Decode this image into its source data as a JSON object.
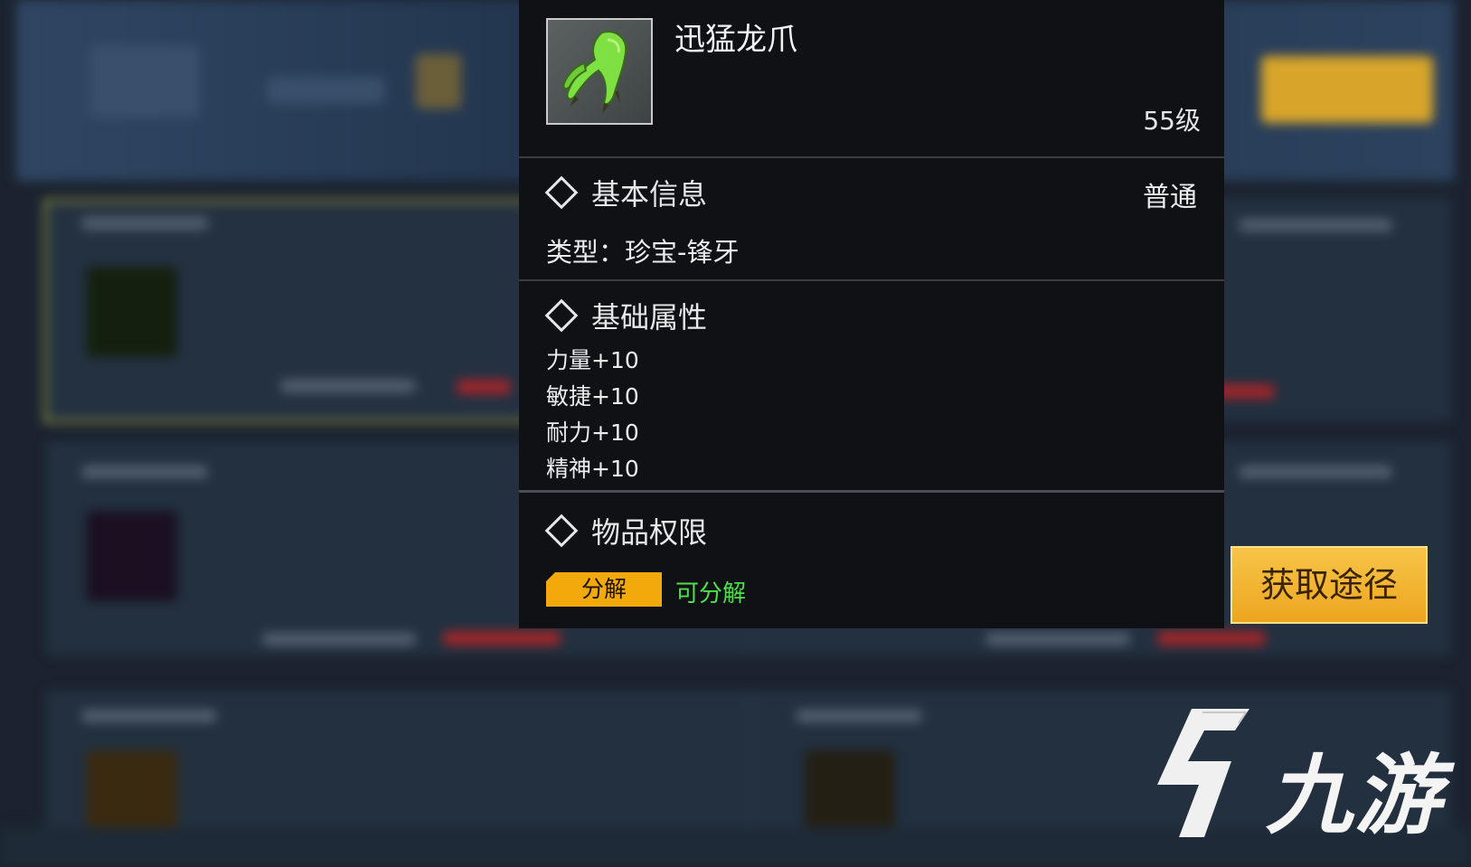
{
  "item": {
    "name": "迅猛龙爪",
    "level": "55级",
    "icon": "green-claw-icon"
  },
  "basic_info": {
    "heading": "基本信息",
    "rarity": "普通",
    "type_line": "类型：珍宝-锋牙"
  },
  "base_attributes": {
    "heading": "基础属性",
    "stats": [
      "力量+10",
      "敏捷+10",
      "耐力+10",
      "精神+10"
    ]
  },
  "permissions": {
    "heading": "物品权限",
    "tag_label": "分解",
    "tag_desc": "可分解"
  },
  "acquire_button": "获取途径",
  "watermark": {
    "text": "九游",
    "icon": "jiuyou-logo-icon"
  },
  "colors": {
    "panel_bg": "#0f1115",
    "tag_bg": "#f2a90c",
    "tag_desc": "#4ee04a",
    "button_bg": "#eda51f"
  }
}
